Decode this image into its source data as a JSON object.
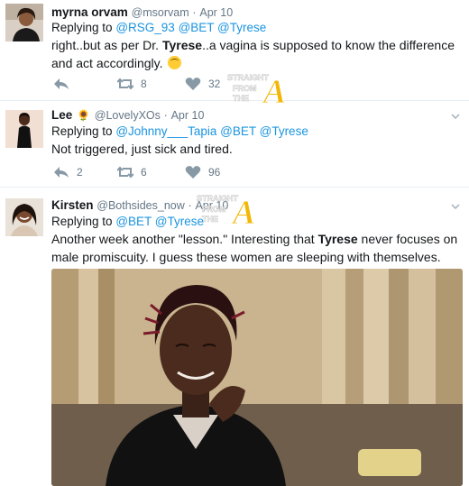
{
  "tweets": [
    {
      "name": "myrna orvam",
      "handle": "@msorvam",
      "separator": "·",
      "date": "Apr 10",
      "replying_label": "Replying to",
      "mentions": [
        "@RSG_93",
        "@BET",
        "@Tyrese"
      ],
      "text_parts": [
        "right..but as per Dr. ",
        "Tyrese",
        "..a vagina is supposed to know the difference and act accordingly."
      ],
      "retweets": "8",
      "likes": "32"
    },
    {
      "name": "Lee",
      "handle": "@LovelyXOs",
      "separator": "·",
      "date": "Apr 10",
      "replying_label": "Replying to",
      "mentions": [
        "@Johnny___Tapia",
        "@BET",
        "@Tyrese"
      ],
      "text": "Not triggered, just sick and tired.",
      "replies": "2",
      "retweets": "6",
      "likes": "96"
    },
    {
      "name": "Kirsten",
      "handle": "@Bothsides_now",
      "separator": "·",
      "date": "Apr 10",
      "replying_label": "Replying to",
      "mentions": [
        "@BET",
        "@Tyrese"
      ],
      "text_parts": [
        "Another week another \"lesson.\" Interesting that ",
        "Tyrese",
        " never focuses on male promiscuity. I guess these women are sleeping with themselves."
      ]
    }
  ],
  "watermark": {
    "line1": "STRAIGHT",
    "line2": "FROM",
    "line3": "THE",
    "letter": "A"
  },
  "colors": {
    "mention": "#1b95e0",
    "meta": "#657786",
    "text": "#14171a",
    "watermark_gold": "#f2b705"
  },
  "icons": [
    "reply-icon",
    "retweet-icon",
    "heart-icon",
    "chevron-down-icon",
    "sunflower-icon",
    "upside-down-face-icon"
  ]
}
